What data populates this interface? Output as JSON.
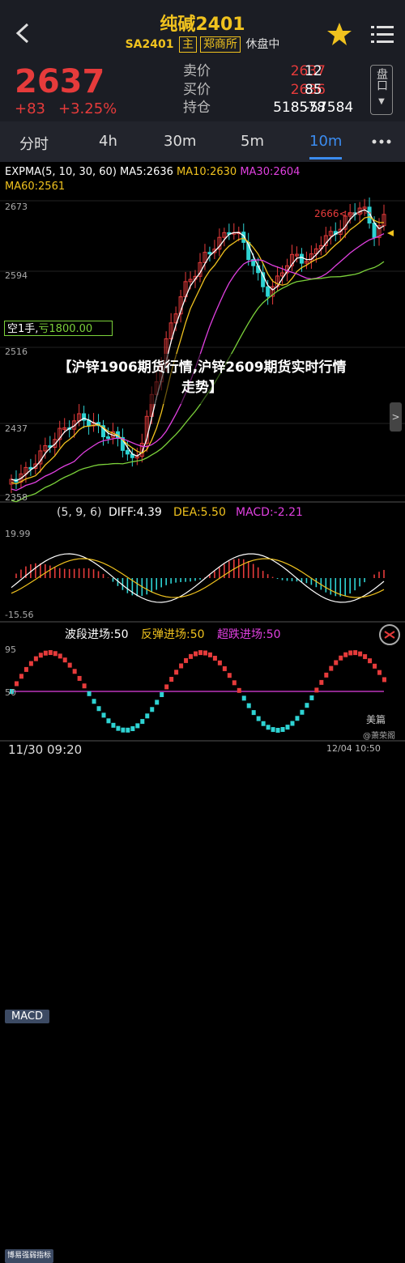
{
  "header": {
    "title": "纯碱2401",
    "code": "SA2401",
    "tag_main": "主",
    "exchange": "郑商所",
    "status": "休盘中"
  },
  "quote": {
    "price": "2637",
    "change": "+83",
    "change_pct": "+3.25%",
    "sell_label": "卖价",
    "sell_price": "2637",
    "sell_vol": "12",
    "buy_label": "买价",
    "buy_price": "2636",
    "buy_vol": "85",
    "oi_label": "持仓",
    "oi": "518578",
    "oi_change": "-57584",
    "pankou": "盘口"
  },
  "tabs": [
    "分时",
    "4h",
    "30m",
    "5m",
    "10m"
  ],
  "active_tab": "10m",
  "legend": {
    "expma": "EXPMA(5, 10, 30, 60)",
    "ma5": "MA5:2636",
    "ma10": "MA10:2630",
    "ma30": "MA30:2604",
    "ma60": "MA60:2561"
  },
  "price_axis": [
    "2673",
    "2594",
    "2516",
    "2437",
    "2358"
  ],
  "high_marker": "2666<--",
  "position_badge": {
    "label": "空1手,",
    "value": "亏1800.00"
  },
  "overlay_text": "【沪锌1906期货行情,沪锌2609期货实时行情走势】",
  "side_handle": ">",
  "macd": {
    "button": "MACD",
    "params": "(5, 9, 6)",
    "diff": "DIFF:4.39",
    "dea": "DEA:5.50",
    "macd": "MACD:-2.21",
    "top": "19.99",
    "bottom": "-15.56"
  },
  "bo": {
    "button": "博易强弱指标",
    "wave": "波段进场:50",
    "rebound": "反弹进场:50",
    "oversold": "超跌进场:50",
    "top": "95",
    "mid": "50"
  },
  "footer": {
    "time_left": "11/30 09:20",
    "time_right": "12/04 10:50"
  },
  "watermark": {
    "brand": "美篇",
    "author": "@萧荣阁"
  },
  "colors": {
    "up": "#e63b3b",
    "down": "#2ed3d3",
    "accent": "#3b8cf0",
    "ma5": "#ffffff",
    "ma10": "#f0c21e",
    "ma30": "#e040e0",
    "ma60": "#7bd13a"
  }
}
